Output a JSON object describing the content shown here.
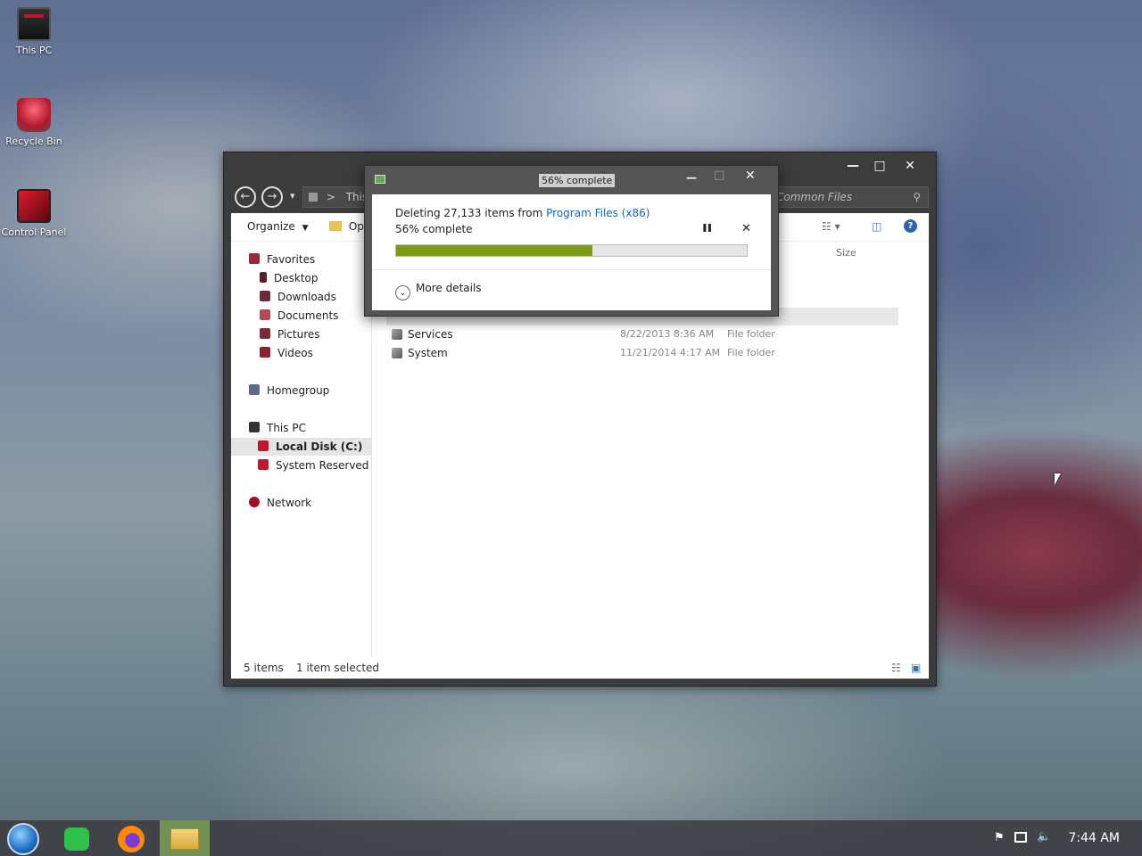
{
  "desktop": {
    "icons": [
      {
        "label": "This PC",
        "icon": "this-pc-icon"
      },
      {
        "label": "Recycle Bin",
        "icon": "recycle-bin-icon"
      },
      {
        "label": "Control Panel",
        "icon": "control-panel-icon"
      }
    ]
  },
  "explorer": {
    "window_controls": {
      "minimize": "—",
      "maximize": "□",
      "close": "✕"
    },
    "nav": {
      "back": "←",
      "forward": "→",
      "dropdown": "▾"
    },
    "address": {
      "separator": ">",
      "text": "This P"
    },
    "search": {
      "text": "Common Files",
      "icon": "search-icon"
    },
    "toolbar": {
      "organize": "Organize",
      "open": "Ope"
    },
    "sidebar": {
      "favorites": "Favorites",
      "items": [
        "Desktop",
        "Downloads",
        "Documents",
        "Pictures",
        "Videos"
      ],
      "homegroup": "Homegroup",
      "this_pc": "This PC",
      "drives": [
        "Local Disk (C:)",
        "System Reserved (D:)"
      ],
      "network": "Network"
    },
    "columns": {
      "size": "Size"
    },
    "files": [
      {
        "name": "Services",
        "date": "8/22/2013 8:36 AM",
        "type": "File folder"
      },
      {
        "name": "System",
        "date": "11/21/2014 4:17 AM",
        "type": "File folder"
      }
    ],
    "status": {
      "items": "5 items",
      "selected": "1 item selected"
    }
  },
  "dialog": {
    "title": "56% complete",
    "deleting_prefix": "Deleting 27,133 items from ",
    "source": "Program Files (x86)",
    "percent_text": "56% complete",
    "progress": 0.56,
    "pause": "❚❚",
    "cancel": "✕",
    "more_details": "More details",
    "controls": {
      "minimize": "—",
      "maximize": "□",
      "close": "✕"
    }
  },
  "taskbar": {
    "apps": [
      "start-orb-icon",
      "messages-icon",
      "firefox-icon",
      "file-explorer-icon"
    ],
    "tray": [
      "flag-icon",
      "network-icon",
      "volume-icon"
    ],
    "clock": "7:44 AM"
  },
  "colors": {
    "progress": "#7d9b15",
    "link": "#1a64b0"
  }
}
